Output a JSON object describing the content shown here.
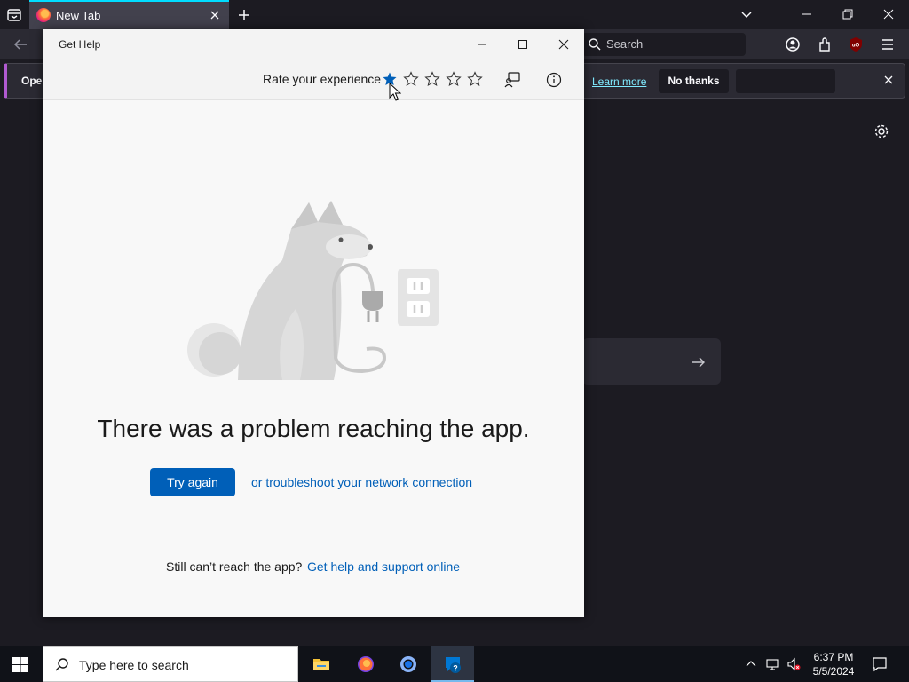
{
  "browser": {
    "tab_title": "New Tab",
    "search_placeholder": "Search",
    "notice": {
      "text": "Oper",
      "learn_more": "Learn more",
      "no_thanks": "No thanks"
    }
  },
  "gethelp": {
    "window_title": "Get Help",
    "rate_label": "Rate your experience",
    "rating": {
      "selected": 1,
      "max": 5
    },
    "error_title": "There was a problem reaching the app.",
    "try_again": "Try again",
    "troubleshoot_link": "or troubleshoot your network connection",
    "still_text": "Still can’t reach the app?",
    "support_link": "Get help and support online"
  },
  "taskbar": {
    "search_placeholder": "Type here to search",
    "time": "6:37 PM",
    "date": "5/5/2024"
  },
  "colors": {
    "accent_blue": "#005fb8",
    "firefox_bg": "#1c1b22",
    "taskbar_bg": "#101218"
  },
  "icons": {
    "tab_list": "list-all-tabs-icon",
    "firefox": "firefox-icon",
    "star_filled": "star-filled-icon",
    "star_empty": "star-empty-icon",
    "feedback": "feedback-icon",
    "info": "info-icon",
    "windows_start": "windows-logo-icon"
  }
}
